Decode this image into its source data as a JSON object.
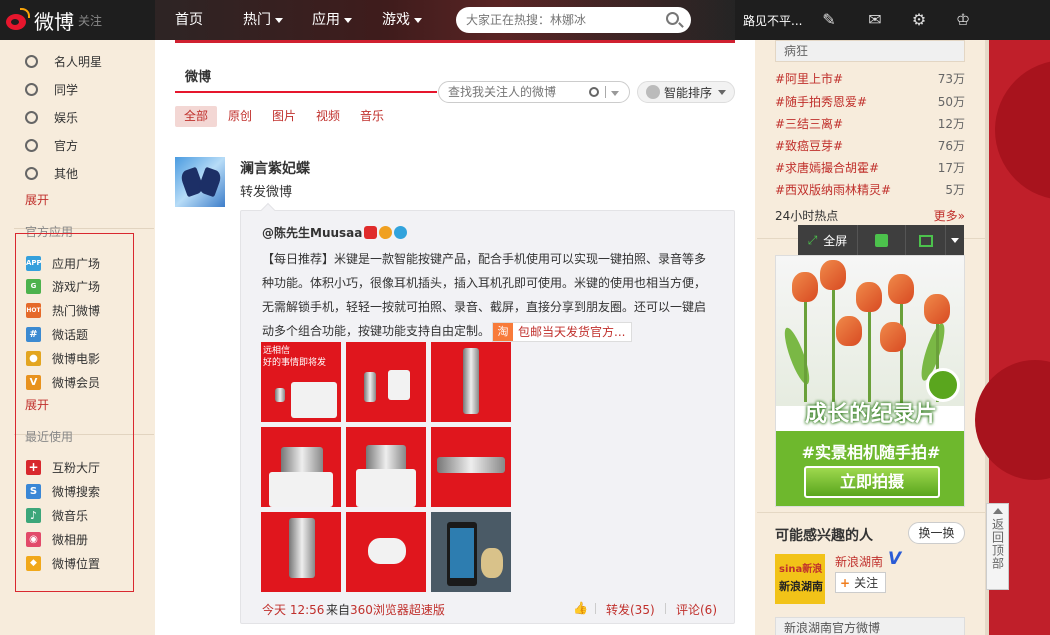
{
  "topbar": {
    "logo_text": "微博",
    "logo_sub": "关注",
    "nav": [
      {
        "label": "首页",
        "caret": false
      },
      {
        "label": "热门",
        "caret": true
      },
      {
        "label": "应用",
        "caret": true
      },
      {
        "label": "游戏",
        "caret": true
      }
    ],
    "search_placeholder": "大家正在热搜：林娜冰",
    "username": "路见不平...",
    "icons": [
      "edit-icon",
      "message-icon",
      "settings-icon",
      "account-icon"
    ]
  },
  "sidebar": {
    "groups": [
      "名人明星",
      "同学",
      "娱乐",
      "官方",
      "其他"
    ],
    "expand1": "展开",
    "apps_title": "官方应用",
    "apps": [
      {
        "label": "应用广场",
        "icon": "APP",
        "color": "#35a0dc"
      },
      {
        "label": "游戏广场",
        "icon": "G",
        "color": "#4db24d"
      },
      {
        "label": "热门微博",
        "icon": "HOT",
        "color": "#e56a2a"
      },
      {
        "label": "微话题",
        "icon": "#",
        "color": "#3c8ad1"
      },
      {
        "label": "微博电影",
        "icon": "●",
        "color": "#e3a520"
      },
      {
        "label": "微博会员",
        "icon": "V",
        "color": "#e8921e"
      }
    ],
    "expand2": "展开",
    "recent_title": "最近使用",
    "recent": [
      {
        "label": "互粉大厅",
        "icon": "+",
        "color": "#d8282e"
      },
      {
        "label": "微博搜索",
        "icon": "S",
        "color": "#3a87d6"
      },
      {
        "label": "微音乐",
        "icon": "♪",
        "color": "#3ca67a"
      },
      {
        "label": "微相册",
        "icon": "◉",
        "color": "#e24a6a"
      },
      {
        "label": "微博位置",
        "icon": "◆",
        "color": "#f1a81a"
      }
    ]
  },
  "feed": {
    "title": "微博",
    "filter_placeholder": "查找我关注人的微博",
    "smart_sort": "智能排序",
    "tabs": [
      "全部",
      "原创",
      "图片",
      "视频",
      "音乐"
    ],
    "post": {
      "author": "澜言紫妃蝶",
      "message": "转发微博",
      "repost": {
        "author": "@陈先生Muusaa",
        "text": "【每日推荐】米键是一款智能按键产品，配合手机使用可以实现一键拍照、录音等多种功能。体积小巧，很像耳机插头，插入耳机孔即可使用。米键的使用也相当方便，无需解锁手机，轻轻一按就可拍照、录音、截屏，直接分享到朋友圈。还可以一键启动多个组合功能，按键功能支持自由定制。",
        "link_label": "包邮当天发货官方...",
        "photo_caption": "远相信\n好的事情即将发",
        "time": "今天 12:56",
        "from_prefix": "来自",
        "from_app": "360浏览器超速版",
        "forward": "转发(35)",
        "comment": "评论(6)"
      }
    }
  },
  "right": {
    "hot_top": "病狂",
    "hot_list": [
      {
        "tag": "#阿里上市#",
        "count": "73万"
      },
      {
        "tag": "#随手拍秀恩爱#",
        "count": "50万"
      },
      {
        "tag": "#三结三离#",
        "count": "12万"
      },
      {
        "tag": "#致癌豆芽#",
        "count": "76万"
      },
      {
        "tag": "#求唐嫣撮合胡霍#",
        "count": "17万"
      },
      {
        "tag": "#西双版纳雨林精灵#",
        "count": "5万"
      }
    ],
    "hot_foot": "24小时热点",
    "more": "更多»",
    "image_tools": {
      "fullscreen": "全屏"
    },
    "ad": {
      "title": "成长的纪录片",
      "hashtag": "#实景相机随手拍#",
      "button": "立即拍摄"
    },
    "maylike_title": "可能感兴趣的人",
    "swap": "换一换",
    "suggest": {
      "avatar_top": "sina新浪",
      "avatar_bottom": "新浪湖南",
      "name": "新浪湖南",
      "verified": "V",
      "follow": "关注",
      "desc": "新浪湖南官方微博"
    },
    "back_top": "返回顶部"
  }
}
